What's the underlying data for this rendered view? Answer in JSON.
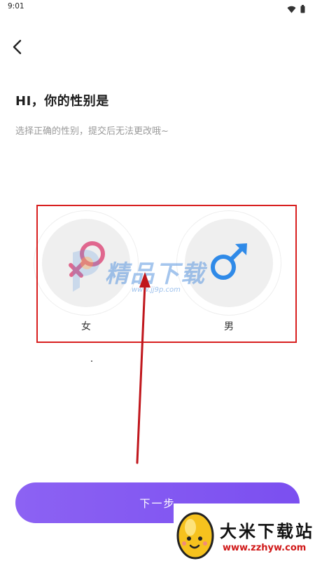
{
  "status_bar": {
    "time": "9:01",
    "icons": [
      "wifi-icon",
      "battery-icon"
    ]
  },
  "header": {
    "back_icon": "chevron-left-icon"
  },
  "main": {
    "title": "HI，你的性别是",
    "subtitle": "选择正确的性别，提交后无法更改哦~",
    "options": [
      {
        "label": "女",
        "icon": "female-symbol-icon",
        "color": "#e0678e"
      },
      {
        "label": "男",
        "icon": "male-symbol-icon",
        "color": "#2f8ae8"
      }
    ]
  },
  "footer": {
    "next_label": "下一步"
  },
  "overlays": {
    "watermark_text": "精品下载",
    "watermark_url": "www.jj9p.com",
    "site_name": "大米下载站",
    "site_url": "www.zzhyw.com",
    "highlight_color": "#d81f1f",
    "arrow_color": "#c0161c"
  },
  "colors": {
    "accent": "#7b4ff0",
    "accent_light": "#8c62f3"
  }
}
